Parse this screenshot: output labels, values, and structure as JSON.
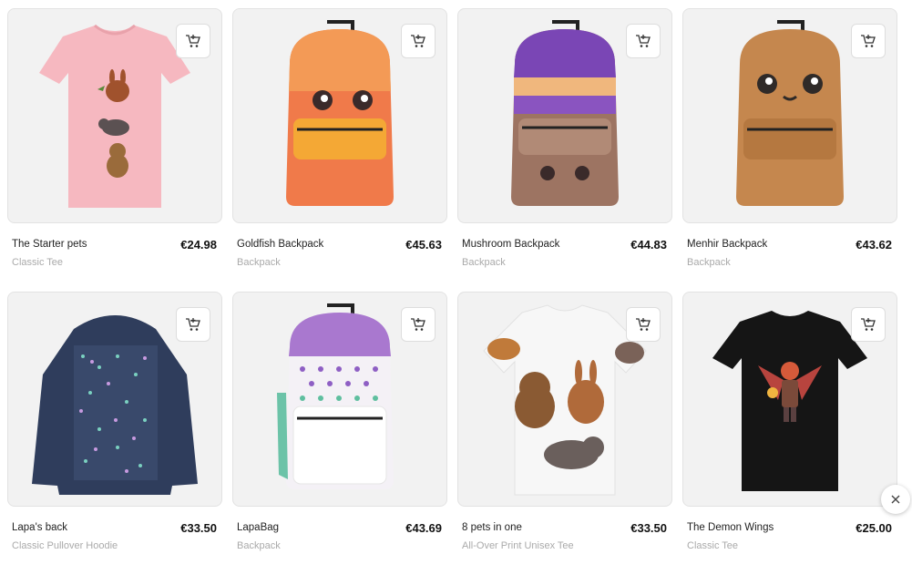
{
  "products": [
    {
      "name": "The Starter pets",
      "type": "Classic Tee",
      "price": "€24.98",
      "art": "pink-tee"
    },
    {
      "name": "Goldfish Backpack",
      "type": "Backpack",
      "price": "€45.63",
      "art": "orange-backpack"
    },
    {
      "name": "Mushroom Backpack",
      "type": "Backpack",
      "price": "€44.83",
      "art": "purple-backpack"
    },
    {
      "name": "Menhir Backpack",
      "type": "Backpack",
      "price": "€43.62",
      "art": "brown-backpack"
    },
    {
      "name": "Lapa's back",
      "type": "Classic Pullover Hoodie",
      "price": "€33.50",
      "art": "navy-hoodie"
    },
    {
      "name": "LapaBag",
      "type": "Backpack",
      "price": "€43.69",
      "art": "dotted-backpack"
    },
    {
      "name": "8 pets in one",
      "type": "All-Over Print Unisex Tee",
      "price": "€33.50",
      "art": "white-print-tee"
    },
    {
      "name": "The Demon Wings",
      "type": "Classic Tee",
      "price": "€25.00",
      "art": "black-tee"
    }
  ],
  "icons": {
    "cart": "add-to-cart-icon",
    "close": "close-icon"
  },
  "colors": {
    "card_bg": "#f2f2f2",
    "price": "#111111",
    "type_text": "#aaaaaa"
  }
}
